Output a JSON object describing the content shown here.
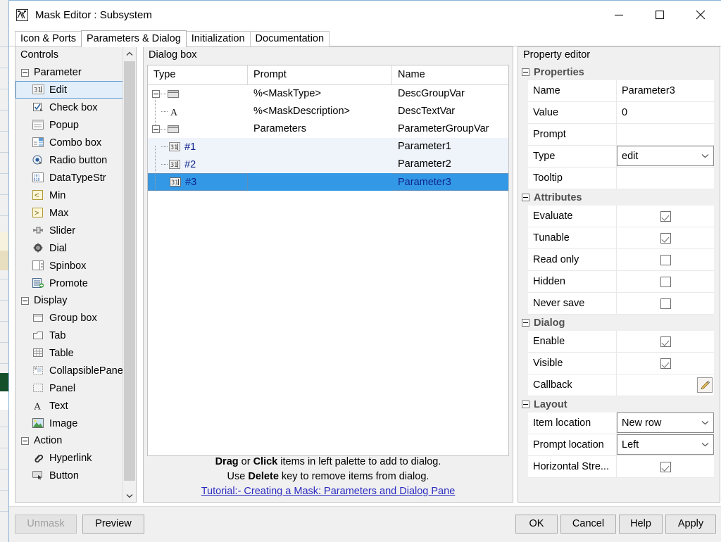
{
  "window": {
    "title": "Mask Editor : Subsystem",
    "icon": "mask-editor-icon",
    "minimize_label": "—",
    "maximize_label": "□",
    "close_label": "✕"
  },
  "tabs": [
    {
      "label": "Icon & Ports",
      "active": false
    },
    {
      "label": "Parameters & Dialog",
      "active": true
    },
    {
      "label": "Initialization",
      "active": false
    },
    {
      "label": "Documentation",
      "active": false
    }
  ],
  "palette": {
    "title": "Controls",
    "groups": [
      {
        "label": "Parameter",
        "items": [
          {
            "label": "Edit",
            "icon": "edit-field-icon",
            "selected": true
          },
          {
            "label": "Check box",
            "icon": "checkbox-icon",
            "selected": false
          },
          {
            "label": "Popup",
            "icon": "popup-icon",
            "selected": false
          },
          {
            "label": "Combo box",
            "icon": "combobox-icon",
            "selected": false
          },
          {
            "label": "Radio button",
            "icon": "radio-button-icon",
            "selected": false
          },
          {
            "label": "DataTypeStr",
            "icon": "datatypestr-icon",
            "selected": false
          },
          {
            "label": "Min",
            "icon": "min-icon",
            "selected": false
          },
          {
            "label": "Max",
            "icon": "max-icon",
            "selected": false
          },
          {
            "label": "Slider",
            "icon": "slider-icon",
            "selected": false
          },
          {
            "label": "Dial",
            "icon": "dial-icon",
            "selected": false
          },
          {
            "label": "Spinbox",
            "icon": "spinbox-icon",
            "selected": false
          },
          {
            "label": "Promote",
            "icon": "promote-icon",
            "selected": false
          }
        ]
      },
      {
        "label": "Display",
        "items": [
          {
            "label": "Group box",
            "icon": "group-box-icon",
            "selected": false
          },
          {
            "label": "Tab",
            "icon": "tab-icon",
            "selected": false
          },
          {
            "label": "Table",
            "icon": "table-icon",
            "selected": false
          },
          {
            "label": "CollapsiblePanel",
            "icon": "collapsible-panel-icon",
            "selected": false
          },
          {
            "label": "Panel",
            "icon": "panel-icon",
            "selected": false
          },
          {
            "label": "Text",
            "icon": "text-icon",
            "selected": false
          },
          {
            "label": "Image",
            "icon": "image-icon",
            "selected": false
          }
        ]
      },
      {
        "label": "Action",
        "items": [
          {
            "label": "Hyperlink",
            "icon": "hyperlink-icon",
            "selected": false
          },
          {
            "label": "Button",
            "icon": "button-icon",
            "selected": false
          }
        ]
      }
    ],
    "scrollbar": {
      "up_icon": "chevron-up-icon",
      "down_icon": "chevron-down-icon"
    }
  },
  "dialog_box": {
    "title": "Dialog box",
    "columns": [
      "Type",
      "Prompt",
      "Name"
    ],
    "rows": [
      {
        "type_label": "",
        "type_icon": "group-box-icon",
        "prompt": "%<MaskType>",
        "name": "DescGroupVar",
        "depth": 0,
        "expander": true,
        "selected": false,
        "alt": false
      },
      {
        "type_label": "",
        "type_icon": "text-icon",
        "prompt": "%<MaskDescription>",
        "name": "DescTextVar",
        "depth": 1,
        "expander": false,
        "selected": false,
        "alt": false
      },
      {
        "type_label": "",
        "type_icon": "group-box-icon",
        "prompt": "Parameters",
        "name": "ParameterGroupVar",
        "depth": 0,
        "expander": true,
        "selected": false,
        "alt": false
      },
      {
        "type_label": "#1",
        "type_icon": "edit-field-icon",
        "prompt": "",
        "name": "Parameter1",
        "depth": 1,
        "expander": false,
        "selected": false,
        "alt": true
      },
      {
        "type_label": "#2",
        "type_icon": "edit-field-icon",
        "prompt": "",
        "name": "Parameter2",
        "depth": 1,
        "expander": false,
        "selected": false,
        "alt": true
      },
      {
        "type_label": "#3",
        "type_icon": "edit-field-icon",
        "prompt": "",
        "name": "Parameter3",
        "depth": 1,
        "expander": false,
        "selected": true,
        "alt": false
      }
    ],
    "hint": {
      "line1_a": "Drag",
      "line1_b": " or ",
      "line1_c": "Click",
      "line1_d": " items in left palette to add to dialog.",
      "line2_a": "Use ",
      "line2_b": "Delete",
      "line2_c": " key to remove items from dialog.",
      "link": "Tutorial:- Creating a Mask: Parameters and Dialog Pane"
    }
  },
  "property_editor": {
    "title": "Property editor",
    "sections": [
      {
        "label": "Properties",
        "rows": [
          {
            "key": "Name",
            "kind": "text",
            "value": "Parameter3"
          },
          {
            "key": "Value",
            "kind": "text",
            "value": "0"
          },
          {
            "key": "Prompt",
            "kind": "text",
            "value": ""
          },
          {
            "key": "Type",
            "kind": "combo",
            "value": "edit"
          },
          {
            "key": "Tooltip",
            "kind": "text",
            "value": ""
          }
        ]
      },
      {
        "label": "Attributes",
        "rows": [
          {
            "key": "Evaluate",
            "kind": "check",
            "checked": true
          },
          {
            "key": "Tunable",
            "kind": "check",
            "checked": true
          },
          {
            "key": "Read only",
            "kind": "check",
            "checked": false
          },
          {
            "key": "Hidden",
            "kind": "check",
            "checked": false
          },
          {
            "key": "Never save",
            "kind": "check",
            "checked": false
          }
        ]
      },
      {
        "label": "Dialog",
        "rows": [
          {
            "key": "Enable",
            "kind": "check",
            "checked": true
          },
          {
            "key": "Visible",
            "kind": "check",
            "checked": true
          },
          {
            "key": "Callback",
            "kind": "pencil",
            "value": ""
          }
        ]
      },
      {
        "label": "Layout",
        "rows": [
          {
            "key": "Item location",
            "kind": "combo",
            "value": "New row"
          },
          {
            "key": "Prompt location",
            "kind": "combo",
            "value": "Left"
          },
          {
            "key": "Horizontal Stre...",
            "kind": "check",
            "checked": true
          }
        ]
      }
    ]
  },
  "buttons": {
    "unmask": {
      "label": "Unmask",
      "disabled": true
    },
    "preview": {
      "label": "Preview",
      "disabled": false
    },
    "ok": {
      "label": "OK",
      "disabled": false
    },
    "cancel": {
      "label": "Cancel",
      "disabled": false
    },
    "help": {
      "label": "Help",
      "disabled": false
    },
    "apply": {
      "label": "Apply",
      "disabled": false
    }
  },
  "colors": {
    "selection_blue": "#3399e6",
    "selection_text": "#10258c",
    "alt_row": "#eff4fb",
    "link": "#2a2ac0",
    "panel_bg": "#f0f0f0"
  }
}
